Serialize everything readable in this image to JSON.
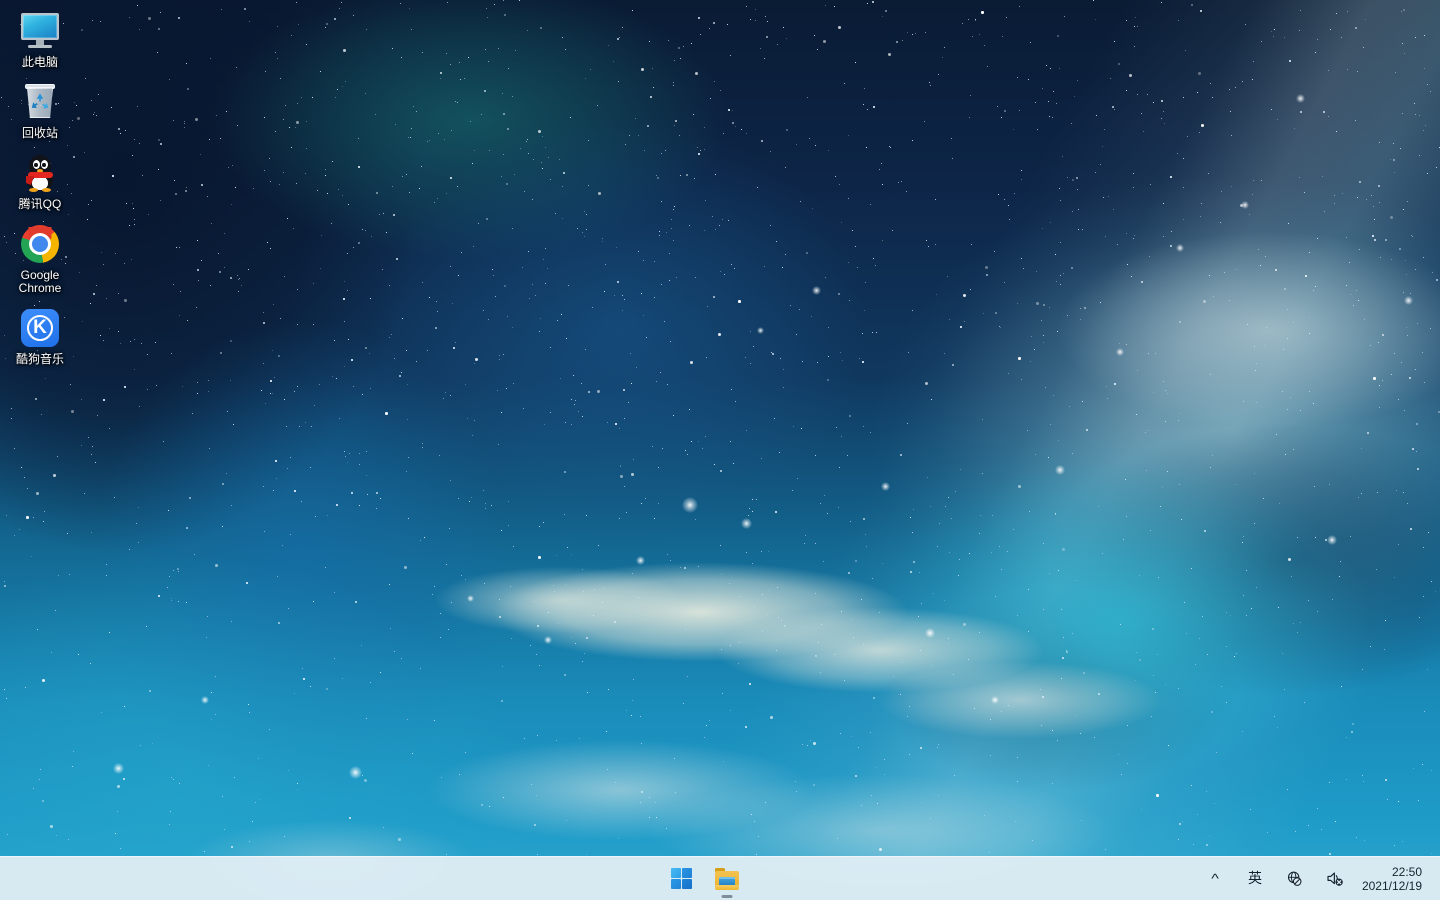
{
  "desktop": {
    "icons": [
      {
        "label": "此电脑",
        "icon": "this-pc-monitor-icon"
      },
      {
        "label": "回收站",
        "icon": "recycle-bin-icon"
      },
      {
        "label": "腾讯QQ",
        "icon": "tencent-qq-penguin-icon"
      },
      {
        "label": "Google Chrome",
        "icon": "google-chrome-icon"
      },
      {
        "label": "酷狗音乐",
        "icon": "kugou-music-icon"
      }
    ],
    "wallpaper": {
      "description": "星空星云桌面壁纸",
      "colors": {
        "deep_navy": "#0a1b34",
        "mid_blue": "#136b95",
        "bright_cyan": "#2aa6cf",
        "nebula_teal": "#28c8e1",
        "cloud_cream": "#e7ebde"
      }
    }
  },
  "taskbar": {
    "start_label": "开始",
    "apps": [
      {
        "label": "文件资源管理器",
        "icon": "file-explorer-icon",
        "running": true
      }
    ],
    "tray": {
      "overflow_label": "显示隐藏的图标",
      "ime_label": "英",
      "network_label": "未连接到网络",
      "volume_label": "已静音"
    },
    "clock": {
      "time": "22:50",
      "date": "2021/12/19"
    },
    "colors": {
      "background": "#e2eef4",
      "text": "#16242e",
      "accent": "#2a96e4"
    }
  }
}
